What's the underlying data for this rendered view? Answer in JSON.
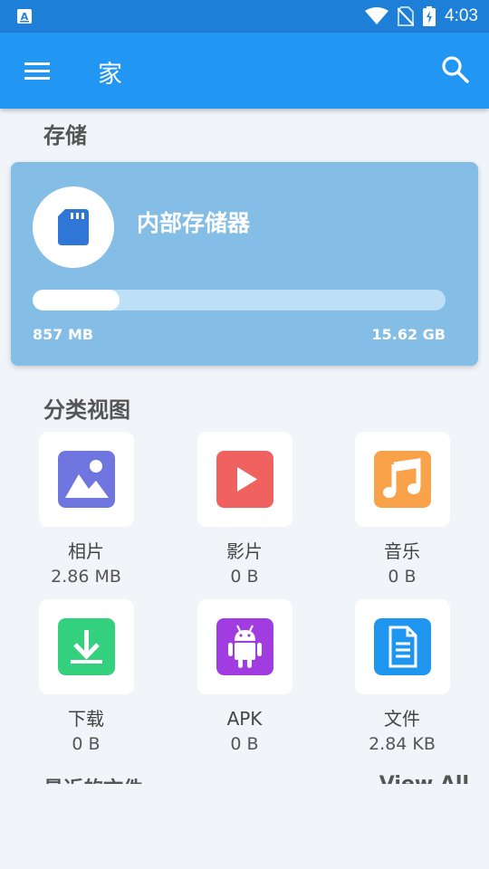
{
  "status_bar": {
    "time": "4:03",
    "icons": [
      "a-notification-icon",
      "wifi-icon",
      "no-sim-icon",
      "battery-charging-icon"
    ]
  },
  "app_bar": {
    "title": "家",
    "menu_icon": "menu-icon",
    "search_icon": "search-icon"
  },
  "storage": {
    "section_title": "存储",
    "name": "内部存储器",
    "used": "857 MB",
    "total": "15.62 GB",
    "progress_fraction": 0.21
  },
  "categories": {
    "section_title": "分类视图",
    "items": [
      {
        "name": "相片",
        "size": "2.86 MB",
        "icon": "image-icon",
        "color": "#7076e0"
      },
      {
        "name": "影片",
        "size": "0 B",
        "icon": "video-icon",
        "color": "#f0625f"
      },
      {
        "name": "音乐",
        "size": "0 B",
        "icon": "music-icon",
        "color": "#f9a24a"
      },
      {
        "name": "下载",
        "size": "0 B",
        "icon": "download-icon",
        "color": "#33d17e"
      },
      {
        "name": "APK",
        "size": "0 B",
        "icon": "android-icon",
        "color": "#a13de0"
      },
      {
        "name": "文件",
        "size": "2.84 KB",
        "icon": "document-icon",
        "color": "#1e96f0"
      }
    ]
  },
  "recent": {
    "title": "最近的文件",
    "view_all": "View All"
  },
  "colors": {
    "status_bar": "#1e7fd8",
    "app_bar": "#2196f3",
    "storage_card": "#84bde5",
    "background": "#f1f4f8"
  }
}
